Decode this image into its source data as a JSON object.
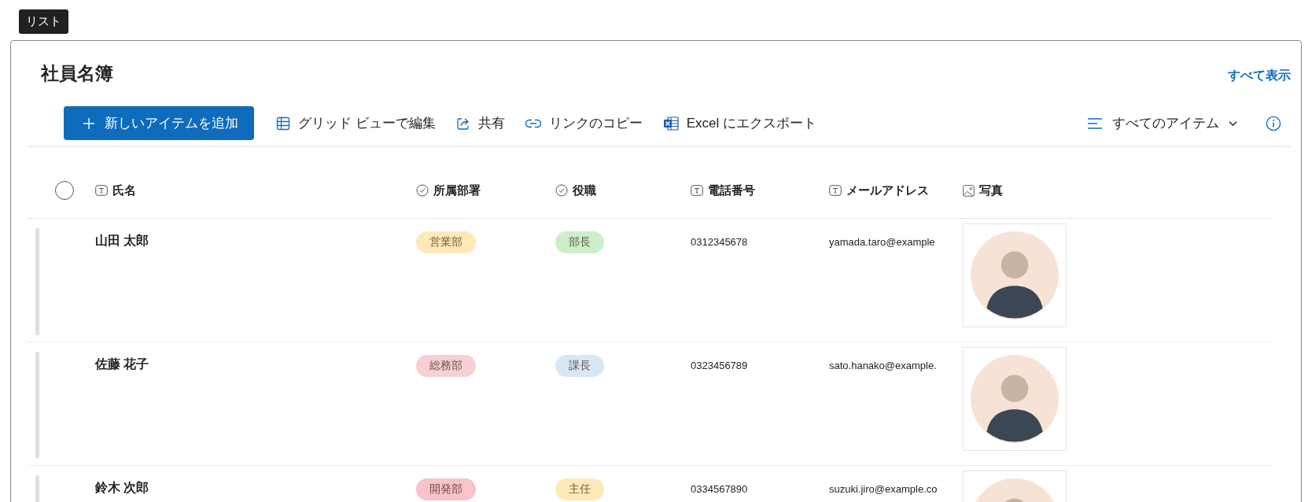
{
  "tab_label": "リスト",
  "list": {
    "title": "社員名簿",
    "see_all": "すべて表示"
  },
  "toolbar": {
    "new_button": "新しいアイテムを追加",
    "actions": [
      {
        "kind": "grid",
        "label": "グリッド ビューで編集"
      },
      {
        "kind": "share",
        "label": "共有"
      },
      {
        "kind": "link",
        "label": "リンクのコピー"
      },
      {
        "kind": "excel",
        "label": "Excel にエクスポート"
      }
    ],
    "view_selector": "すべてのアイテム"
  },
  "table": {
    "select_all": {
      "checked": false
    },
    "columns": [
      {
        "kind": "text",
        "label": "氏名"
      },
      {
        "kind": "choice",
        "label": "所属部署"
      },
      {
        "kind": "choice",
        "label": "役職"
      },
      {
        "kind": "text",
        "label": "電話番号"
      },
      {
        "kind": "text",
        "label": "メールアドレス"
      },
      {
        "kind": "image",
        "label": "写真"
      }
    ],
    "rows": [
      {
        "name": "山田 太郎",
        "department": {
          "label": "営業部",
          "color": "#fdeab8"
        },
        "position": {
          "label": "部長",
          "color": "#cdeecb"
        },
        "phone": "0312345678",
        "email": "yamada.taro@example"
      },
      {
        "name": "佐藤 花子",
        "department": {
          "label": "総務部",
          "color": "#f6d0d4"
        },
        "position": {
          "label": "課長",
          "color": "#d6e8f6"
        },
        "phone": "0323456789",
        "email": "sato.hanako@example."
      },
      {
        "name": "鈴木 次郎",
        "department": {
          "label": "開発部",
          "color": "#f7c4cb"
        },
        "position": {
          "label": "主任",
          "color": "#fdeab8"
        },
        "phone": "0334567890",
        "email": "suzuki.jiro@example.co"
      }
    ]
  }
}
